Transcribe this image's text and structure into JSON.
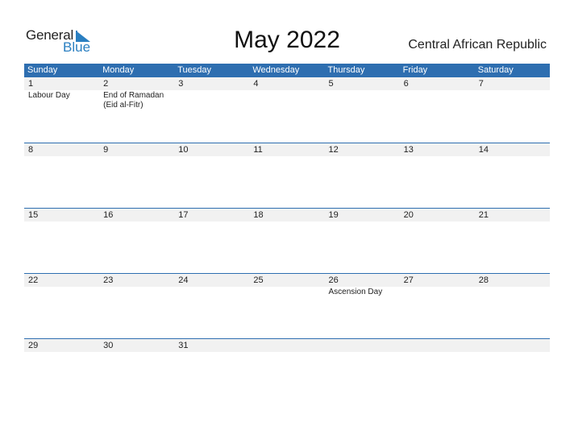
{
  "logo": {
    "part1": "General",
    "part2": "Blue"
  },
  "header": {
    "title": "May 2022",
    "country": "Central African Republic"
  },
  "colors": {
    "accent": "#2e6eb0",
    "band": "#f1f1f1"
  },
  "weekdays": [
    "Sunday",
    "Monday",
    "Tuesday",
    "Wednesday",
    "Thursday",
    "Friday",
    "Saturday"
  ],
  "weeks": [
    [
      {
        "day": "1",
        "event": "Labour Day"
      },
      {
        "day": "2",
        "event": "End of Ramadan (Eid al-Fitr)"
      },
      {
        "day": "3",
        "event": ""
      },
      {
        "day": "4",
        "event": ""
      },
      {
        "day": "5",
        "event": ""
      },
      {
        "day": "6",
        "event": ""
      },
      {
        "day": "7",
        "event": ""
      }
    ],
    [
      {
        "day": "8",
        "event": ""
      },
      {
        "day": "9",
        "event": ""
      },
      {
        "day": "10",
        "event": ""
      },
      {
        "day": "11",
        "event": ""
      },
      {
        "day": "12",
        "event": ""
      },
      {
        "day": "13",
        "event": ""
      },
      {
        "day": "14",
        "event": ""
      }
    ],
    [
      {
        "day": "15",
        "event": ""
      },
      {
        "day": "16",
        "event": ""
      },
      {
        "day": "17",
        "event": ""
      },
      {
        "day": "18",
        "event": ""
      },
      {
        "day": "19",
        "event": ""
      },
      {
        "day": "20",
        "event": ""
      },
      {
        "day": "21",
        "event": ""
      }
    ],
    [
      {
        "day": "22",
        "event": ""
      },
      {
        "day": "23",
        "event": ""
      },
      {
        "day": "24",
        "event": ""
      },
      {
        "day": "25",
        "event": ""
      },
      {
        "day": "26",
        "event": "Ascension Day"
      },
      {
        "day": "27",
        "event": ""
      },
      {
        "day": "28",
        "event": ""
      }
    ],
    [
      {
        "day": "29",
        "event": ""
      },
      {
        "day": "30",
        "event": ""
      },
      {
        "day": "31",
        "event": ""
      },
      {
        "day": "",
        "event": ""
      },
      {
        "day": "",
        "event": ""
      },
      {
        "day": "",
        "event": ""
      },
      {
        "day": "",
        "event": ""
      }
    ]
  ]
}
